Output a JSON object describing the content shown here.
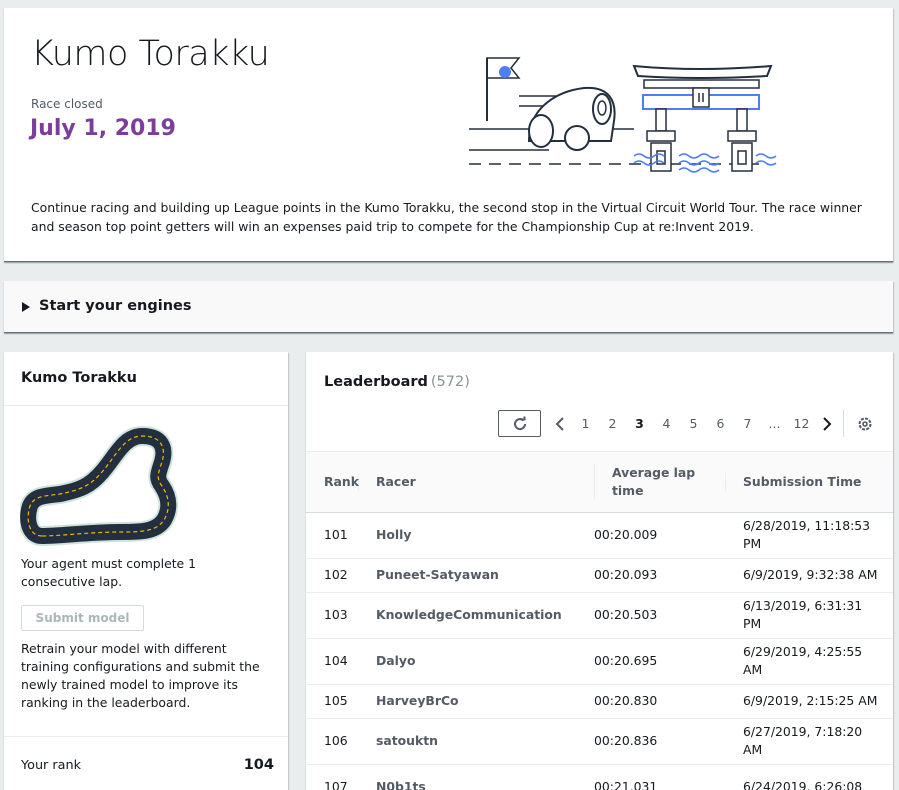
{
  "race": {
    "title": "Kumo Torakku",
    "status": "Race closed",
    "date": "July 1, 2019",
    "description": "Continue racing and building up League points in the Kumo Torakku, the second stop in the Virtual Circuit World Tour. The race winner and season top point getters will win an expenses paid trip to compete for the Championship Cup at re:Invent 2019."
  },
  "engines": {
    "label": "Start your engines"
  },
  "track": {
    "title": "Kumo Torakku",
    "requirement": "Your agent must complete 1 consecutive lap.",
    "submit_label": "Submit model",
    "hint": "Retrain your model with different training configurations and submit the newly trained model to improve its ranking in the leaderboard.",
    "rank_label": "Your rank",
    "rank_value": "104"
  },
  "leaderboard": {
    "title": "Leaderboard",
    "count": "(572)",
    "pages": [
      "1",
      "2",
      "3",
      "4",
      "5",
      "6",
      "7",
      "...",
      "12"
    ],
    "active_page": "3",
    "columns": [
      "Rank",
      "Racer",
      "Average lap time",
      "Submission Time"
    ],
    "rows": [
      {
        "rank": "101",
        "racer": "Holly",
        "time": "00:20.009",
        "submitted": "6/28/2019, 11:18:53 PM"
      },
      {
        "rank": "102",
        "racer": "Puneet-Satyawan",
        "time": "00:20.093",
        "submitted": "6/9/2019, 9:32:38 AM"
      },
      {
        "rank": "103",
        "racer": "KnowledgeCommunication",
        "time": "00:20.503",
        "submitted": "6/13/2019, 6:31:31 PM"
      },
      {
        "rank": "104",
        "racer": "Dalyo",
        "time": "00:20.695",
        "submitted": "6/29/2019, 4:25:55 AM"
      },
      {
        "rank": "105",
        "racer": "HarveyBrCo",
        "time": "00:20.830",
        "submitted": "6/9/2019, 2:15:25 AM"
      },
      {
        "rank": "106",
        "racer": "satouktn",
        "time": "00:20.836",
        "submitted": "6/27/2019, 7:18:20 AM"
      },
      {
        "rank": "107",
        "racer": "N0b1ts",
        "time": "00:21.031",
        "submitted": "6/24/2019, 6:26:08"
      }
    ]
  },
  "colors": {
    "accent_purple": "#7d3d9a",
    "illustration_blue": "#4f7df3",
    "line_dark": "#232f3e"
  },
  "icons": {
    "caret": "caret-right-icon",
    "refresh": "refresh-icon",
    "prev": "chevron-left-icon",
    "next": "chevron-right-icon",
    "settings": "gear-icon"
  }
}
